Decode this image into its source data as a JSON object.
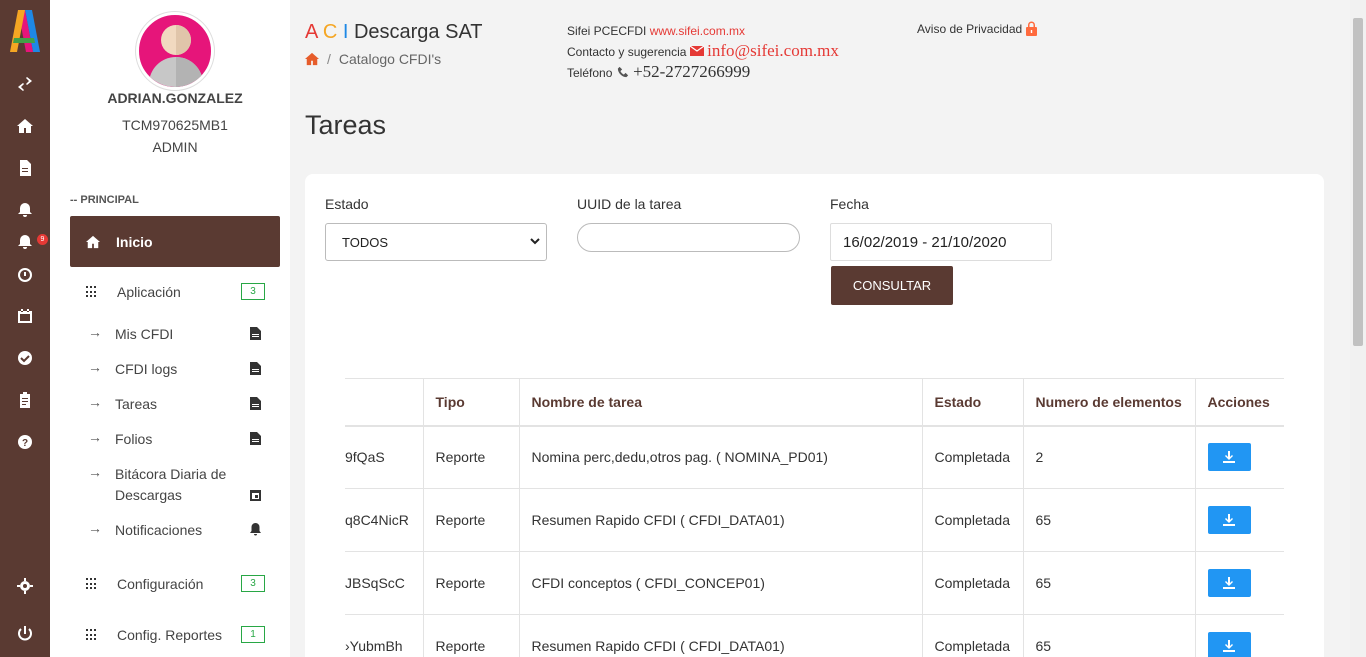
{
  "rail": {
    "icons": [
      "logo",
      "swap-icon",
      "home-icon",
      "file-icon",
      "bell-icon",
      "bell-alert-icon",
      "alarm-icon",
      "calendar-icon",
      "check-circle-icon",
      "clipboard-icon",
      "help-icon",
      "gear-icon",
      "power-icon"
    ],
    "notification_count": "9"
  },
  "user": {
    "name": "ADRIAN.GONZALEZ",
    "rfc": "TCM970625MB1",
    "role": "ADMIN"
  },
  "sidebar": {
    "section": "-- PRINCIPAL",
    "active_item": "Inicio",
    "groups": [
      {
        "label": "Aplicación",
        "count": "3"
      },
      {
        "label": "Configuración",
        "count": "3"
      },
      {
        "label": "Config. Reportes",
        "count": "1"
      }
    ],
    "subitems": [
      {
        "arrow": "→",
        "label": "Mis CFDI",
        "icon": "file-icon"
      },
      {
        "arrow": "→",
        "label": "CFDI logs",
        "icon": "file-icon"
      },
      {
        "arrow": "→",
        "label": "Tareas",
        "icon": "file-icon"
      },
      {
        "arrow": "→",
        "label": "Folios",
        "icon": "file-icon"
      },
      {
        "arrow": "→",
        "label": "Bitácora Diaria de Descargas",
        "icon": "calendar-icon"
      },
      {
        "arrow": "→",
        "label": "Notificaciones",
        "icon": "bell-icon"
      }
    ]
  },
  "header": {
    "brand_a": "A",
    "brand_c": "C",
    "brand_i": "I",
    "brand_title": "Descarga SAT",
    "breadcrumb_sep": "/",
    "breadcrumb": "Catalogo CFDI's",
    "contact_line1_label": "Sifei PCECFDI",
    "contact_line1_link": "www.sifei.com.mx",
    "contact_line2_label": "Contacto y sugerencia",
    "contact_email": "info@sifei.com.mx",
    "contact_line3_label": "Teléfono",
    "contact_phone": "+52-2727266999",
    "privacy": "Aviso de Privacidad"
  },
  "page": {
    "title": "Tareas"
  },
  "filters": {
    "estado_label": "Estado",
    "estado_value": "TODOS",
    "uuid_label": "UUID de la tarea",
    "uuid_value": "",
    "fecha_label": "Fecha",
    "fecha_value": "16/02/2019 - 21/10/2020",
    "consultar_label": "CONSULTAR"
  },
  "table": {
    "headers": [
      "",
      "Tipo",
      "Nombre de tarea",
      "Estado",
      "Numero de elementos",
      "Acciones"
    ],
    "rows": [
      {
        "uuid": "9fQaS",
        "tipo": "Reporte",
        "nombre": "Nomina perc,dedu,otros pag. ( NOMINA_PD01)",
        "estado": "Completada",
        "elementos": "2"
      },
      {
        "uuid": "q8C4NicR",
        "tipo": "Reporte",
        "nombre": "Resumen Rapido CFDI ( CFDI_DATA01)",
        "estado": "Completada",
        "elementos": "65"
      },
      {
        "uuid": "JBSqScC",
        "tipo": "Reporte",
        "nombre": "CFDI conceptos ( CFDI_CONCEP01)",
        "estado": "Completada",
        "elementos": "65"
      },
      {
        "uuid": "›YubmBh",
        "tipo": "Reporte",
        "nombre": "Resumen Rapido CFDI ( CFDI_DATA01)",
        "estado": "Completada",
        "elementos": "65"
      }
    ]
  },
  "colors": {
    "primary": "#5a3a32",
    "accent_blue": "#2196f3",
    "badge_green": "#28a745",
    "link_red": "#e53935"
  }
}
